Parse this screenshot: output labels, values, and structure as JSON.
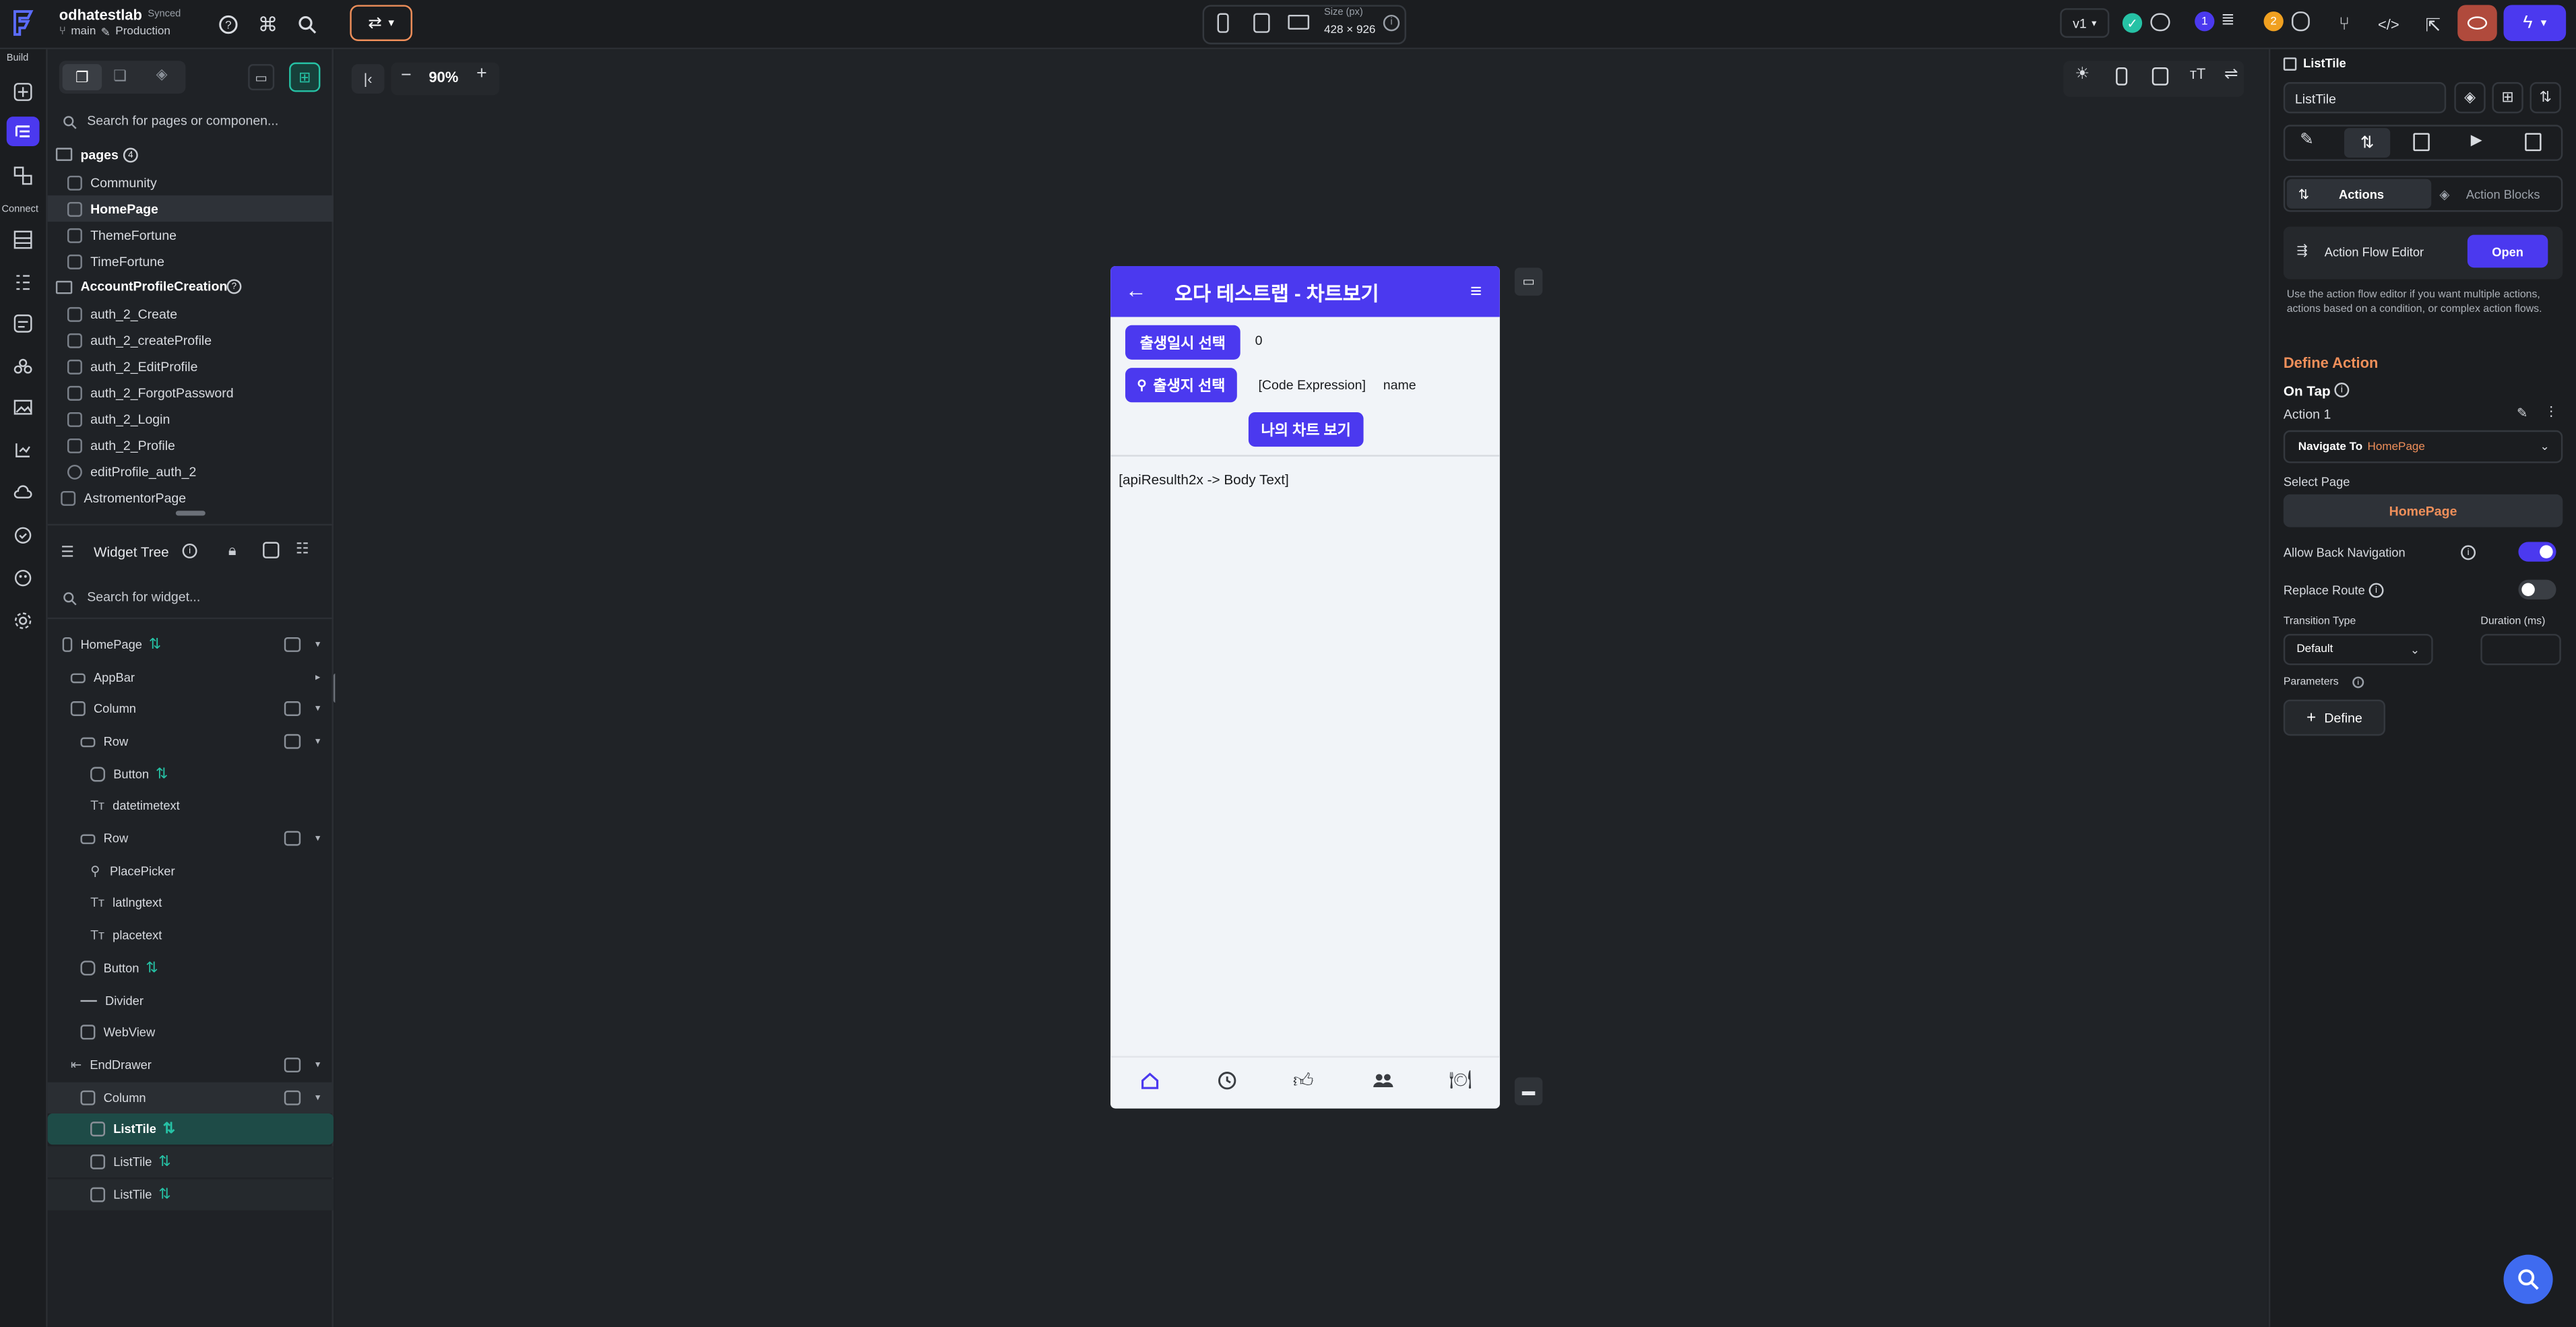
{
  "project": {
    "name": "odhatestlab",
    "sync": "Synced",
    "branch": "main",
    "env": "Production"
  },
  "device": {
    "size_label": "Size (px)",
    "size_value": "428 × 926"
  },
  "topbar": {
    "version": "v1",
    "notif_count": "1",
    "warn_count": "2"
  },
  "rail": {
    "build_label": "Build",
    "connect_label": "Connect"
  },
  "pages": {
    "search_placeholder": "Search for pages or componen...",
    "header": "pages",
    "header_count": "4",
    "items": [
      "Community",
      "HomePage",
      "ThemeFortune",
      "TimeFortune"
    ],
    "folder": "AccountProfileCreation",
    "folder_items": [
      "auth_2_Create",
      "auth_2_createProfile",
      "auth_2_EditProfile",
      "auth_2_ForgotPassword",
      "auth_2_Login",
      "auth_2_Profile",
      "editProfile_auth_2",
      "AstromentorPage"
    ]
  },
  "widget_tree": {
    "title": "Widget Tree",
    "search_placeholder": "Search for widget...",
    "nodes": [
      {
        "label": "HomePage"
      },
      {
        "label": "AppBar"
      },
      {
        "label": "Column"
      },
      {
        "label": "Row"
      },
      {
        "label": "Button"
      },
      {
        "label": "datetimetext"
      },
      {
        "label": "Row"
      },
      {
        "label": "PlacePicker"
      },
      {
        "label": "latlngtext"
      },
      {
        "label": "placetext"
      },
      {
        "label": "Button"
      },
      {
        "label": "Divider"
      },
      {
        "label": "WebView"
      },
      {
        "label": "EndDrawer"
      },
      {
        "label": "Column"
      },
      {
        "label": "ListTile"
      },
      {
        "label": "ListTile"
      },
      {
        "label": "ListTile"
      }
    ]
  },
  "canvas": {
    "zoom": "90%"
  },
  "phone": {
    "title": "오다 테스트랩 - 차트보기",
    "btn_birth_time": "출생일시 선택",
    "datetime_value": "0",
    "btn_birth_place": "출생지 선택",
    "code_expression": "[Code Expression]",
    "place_name": "name",
    "btn_my_chart": "나의 차트 보기",
    "body_text": "[apiResulth2x -> Body Text]"
  },
  "properties": {
    "widget_type": "ListTile",
    "widget_name": "ListTile",
    "tab_actions": "Actions",
    "tab_action_blocks": "Action Blocks",
    "flow_editor_label": "Action Flow Editor",
    "flow_editor_button": "Open",
    "flow_editor_help": "Use the action flow editor if you want multiple actions, actions based on a condition, or complex action flows.",
    "define_action": "Define Action",
    "on_tap": "On Tap",
    "action_1": "Action 1",
    "navigate_to_label": "Navigate To",
    "navigate_to_page": "HomePage",
    "select_page_label": "Select Page",
    "select_page_value": "HomePage",
    "allow_back_label": "Allow Back Navigation",
    "allow_back": true,
    "replace_route_label": "Replace Route",
    "replace_route": false,
    "transition_label": "Transition Type",
    "transition_value": "Default",
    "duration_label": "Duration (ms)",
    "parameters_label": "Parameters",
    "define_button": "Define"
  },
  "colors": {
    "accent": "#4b39ef",
    "teal": "#26c2a5",
    "orange": "#ef8f5a"
  }
}
